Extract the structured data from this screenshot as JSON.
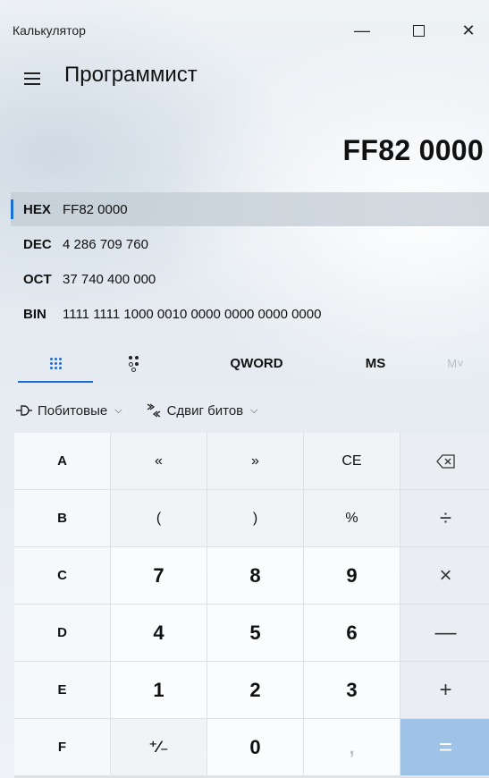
{
  "window": {
    "title": "Калькулятор",
    "minimize_glyph": "—",
    "close_glyph": "✕"
  },
  "header": {
    "mode": "Программист"
  },
  "display": {
    "value": "FF82 0000"
  },
  "radix": [
    {
      "label": "HEX",
      "value": "FF82 0000",
      "active": true
    },
    {
      "label": "DEC",
      "value": "4 286 709 760"
    },
    {
      "label": "OCT",
      "value": "37 740 400 000"
    },
    {
      "label": "BIN",
      "value": "1111 1111 1000 0010 0000 0000 0000 0000"
    }
  ],
  "toolbar": {
    "word_size": "QWORD",
    "memory_store": "MS",
    "memory_view": "M˅"
  },
  "operators": {
    "bitwise_label": "Побитовые",
    "bitshift_label": "Сдвиг битов"
  },
  "keys": {
    "row1": [
      "A",
      "«",
      "»",
      "CE",
      "⌫"
    ],
    "row2": [
      "B",
      "(",
      ")",
      "%",
      "÷"
    ],
    "row3": [
      "C",
      "7",
      "8",
      "9",
      "×"
    ],
    "row4": [
      "D",
      "4",
      "5",
      "6",
      "—"
    ],
    "row5": [
      "E",
      "1",
      "2",
      "3",
      "+"
    ],
    "row6": [
      "F",
      "⁺∕₋",
      "0",
      ",",
      "="
    ]
  },
  "colors": {
    "accent": "#1a6fd2",
    "equals_bg": "#9ec3e6"
  },
  "icons": {
    "menu": "hamburger-icon",
    "keypad": "keypad-grid-icon",
    "bit_toggle": "bit-toggle-icon",
    "bitwise": "logic-gate-icon",
    "bitshift": "bit-shift-icon",
    "backspace": "backspace-icon"
  }
}
